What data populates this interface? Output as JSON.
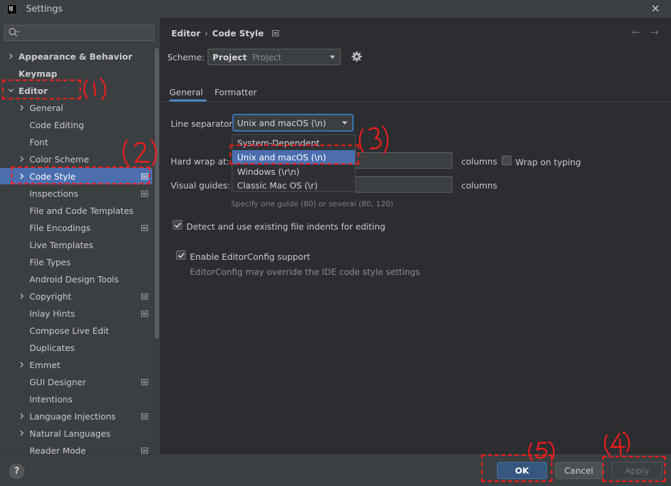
{
  "window": {
    "title": "Settings",
    "logo": "IJ",
    "close_glyph": "✕"
  },
  "search": {
    "placeholder": "",
    "value": ""
  },
  "sidebar": {
    "items": [
      {
        "label": "Appearance & Behavior",
        "level": 0,
        "bold": true,
        "expandable": true,
        "expanded": false,
        "project": false
      },
      {
        "label": "Keymap",
        "level": 0,
        "bold": true,
        "expandable": false,
        "project": false
      },
      {
        "label": "Editor",
        "level": 0,
        "bold": true,
        "expandable": true,
        "expanded": true,
        "project": false
      },
      {
        "label": "General",
        "level": 1,
        "expandable": true,
        "expanded": false,
        "project": false
      },
      {
        "label": "Code Editing",
        "level": 1,
        "expandable": false,
        "project": false
      },
      {
        "label": "Font",
        "level": 1,
        "expandable": false,
        "project": false
      },
      {
        "label": "Color Scheme",
        "level": 1,
        "expandable": true,
        "expanded": false,
        "project": false
      },
      {
        "label": "Code Style",
        "level": 1,
        "expandable": true,
        "expanded": false,
        "selected": true,
        "project": true
      },
      {
        "label": "Inspections",
        "level": 1,
        "expandable": false,
        "project": true
      },
      {
        "label": "File and Code Templates",
        "level": 1,
        "expandable": false,
        "project": false
      },
      {
        "label": "File Encodings",
        "level": 1,
        "expandable": false,
        "project": true
      },
      {
        "label": "Live Templates",
        "level": 1,
        "expandable": false,
        "project": false
      },
      {
        "label": "File Types",
        "level": 1,
        "expandable": false,
        "project": false
      },
      {
        "label": "Android Design Tools",
        "level": 1,
        "expandable": false,
        "project": false
      },
      {
        "label": "Copyright",
        "level": 1,
        "expandable": true,
        "expanded": false,
        "project": true
      },
      {
        "label": "Inlay Hints",
        "level": 1,
        "expandable": false,
        "project": true
      },
      {
        "label": "Compose Live Edit",
        "level": 1,
        "expandable": false,
        "project": false
      },
      {
        "label": "Duplicates",
        "level": 1,
        "expandable": false,
        "project": false
      },
      {
        "label": "Emmet",
        "level": 1,
        "expandable": true,
        "expanded": false,
        "project": false
      },
      {
        "label": "GUI Designer",
        "level": 1,
        "expandable": false,
        "project": true
      },
      {
        "label": "Intentions",
        "level": 1,
        "expandable": false,
        "project": false
      },
      {
        "label": "Language Injections",
        "level": 1,
        "expandable": true,
        "expanded": false,
        "project": true
      },
      {
        "label": "Natural Languages",
        "level": 1,
        "expandable": true,
        "expanded": false,
        "project": false
      },
      {
        "label": "Reader Mode",
        "level": 1,
        "expandable": false,
        "project": true
      }
    ]
  },
  "breadcrumb": {
    "parent": "Editor",
    "separator": "›",
    "current": "Code Style"
  },
  "nav": {
    "back": "←",
    "forward": "→"
  },
  "scheme": {
    "label": "Scheme:",
    "value": "Project",
    "sub": "Project"
  },
  "tabs": [
    {
      "label": "General",
      "active": true
    },
    {
      "label": "Formatter",
      "active": false
    }
  ],
  "line_separator": {
    "label": "Line separator:",
    "value": "Unix and macOS (\\n)",
    "options": [
      "System-Dependent",
      "Unix and macOS (\\n)",
      "Windows (\\r\\n)",
      "Classic Mac OS (\\r)"
    ],
    "selected_index": 1
  },
  "hard_wrap": {
    "label": "Hard wrap at:",
    "value": "",
    "units": "columns"
  },
  "wrap_on_typing": {
    "label": "Wrap on typing",
    "checked": false
  },
  "visual_guides": {
    "label": "Visual guides:",
    "value": "",
    "units": "columns",
    "hint": "Specify one guide (80) or several (80, 120)"
  },
  "detect_indents": {
    "label": "Detect and use existing file indents for editing",
    "checked": true
  },
  "editorconfig": {
    "label": "Enable EditorConfig support",
    "checked": true,
    "hint": "EditorConfig may override the IDE code style settings"
  },
  "footer": {
    "help": "?",
    "ok": "OK",
    "cancel": "Cancel",
    "apply": "Apply"
  },
  "colors": {
    "accent": "#4b6eaf",
    "annotation": "#ff1a1a",
    "background": "#2b2d30",
    "panel": "#3c3f41"
  }
}
